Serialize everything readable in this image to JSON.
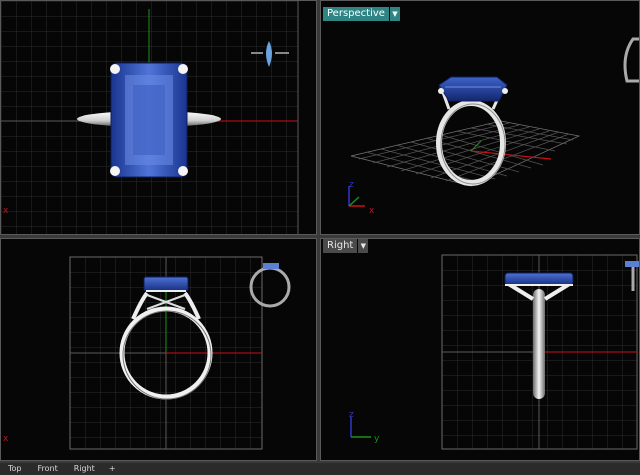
{
  "viewports": {
    "top": {
      "label": "",
      "active": false
    },
    "perspective": {
      "label": "Perspective",
      "active": true
    },
    "front": {
      "label": "",
      "active": false
    },
    "right": {
      "label": "Right",
      "active": false
    }
  },
  "axis_labels": {
    "x": "x",
    "y": "y",
    "z": "z"
  },
  "tabs": [
    "Top",
    "Front",
    "Right"
  ],
  "tab_add": "+",
  "colors": {
    "grid_minor": "#2c2c2c",
    "grid_major": "#6a6a6a",
    "axis_x": "#c8101a",
    "axis_y": "#1d8e1d",
    "axis_z": "#2f37c9",
    "gem": "#1f3f9c",
    "gem_light": "#5c80e0",
    "metal": "#e8e8e8",
    "label_active": "#2f8583"
  }
}
